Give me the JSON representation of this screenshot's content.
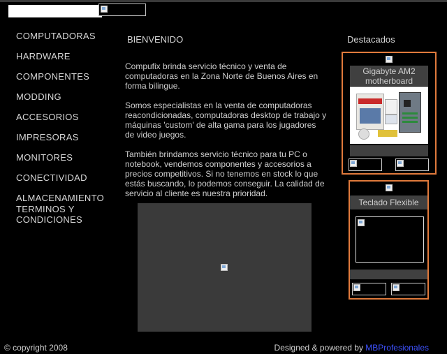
{
  "header": {
    "search_placeholder": ""
  },
  "nav": {
    "items": [
      "COMPUTADORAS",
      "HARDWARE",
      "COMPONENTES",
      "MODDING",
      "ACCESORIOS",
      "IMPRESORAS",
      "MONITORES",
      "CONECTIVIDAD",
      "ALMACENAMIENTO"
    ],
    "terms_line1": "TERMINOS Y",
    "terms_line2": "CONDICIONES"
  },
  "main": {
    "title": "BIENVENIDO",
    "paragraphs": [
      "Compufix brinda servicio técnico y venta de computadoras en la Zona Norte de Buenos Aires en forma bilingue.",
      "Somos especialistas en la venta de computadoras reacondicionadas, computadoras desktop de trabajo y máquinas 'custom' de alta gama para los jugadores de video juegos.",
      "También brindamos servicio técnico para tu PC o notebook, vendemos componentes y accesorios a precios competitivos. Si no tenemos en stock lo que estás buscando, lo podemos conseguir. La calidad de servicio al cliente es nuestra prioridad."
    ]
  },
  "featured": {
    "title": "Destacados",
    "products": [
      {
        "name": "Gigabyte AM2 motherboard"
      },
      {
        "name": "Teclado Flexible"
      }
    ]
  },
  "footer": {
    "copyright": "© copyright 2008",
    "credits_prefix": "Designed & powered by ",
    "credits_link": "MBProfesionales"
  },
  "colors": {
    "background": "#000000",
    "card_border": "#e07a3c",
    "panel_gray": "#404040",
    "link_blue": "#3e52ff"
  }
}
